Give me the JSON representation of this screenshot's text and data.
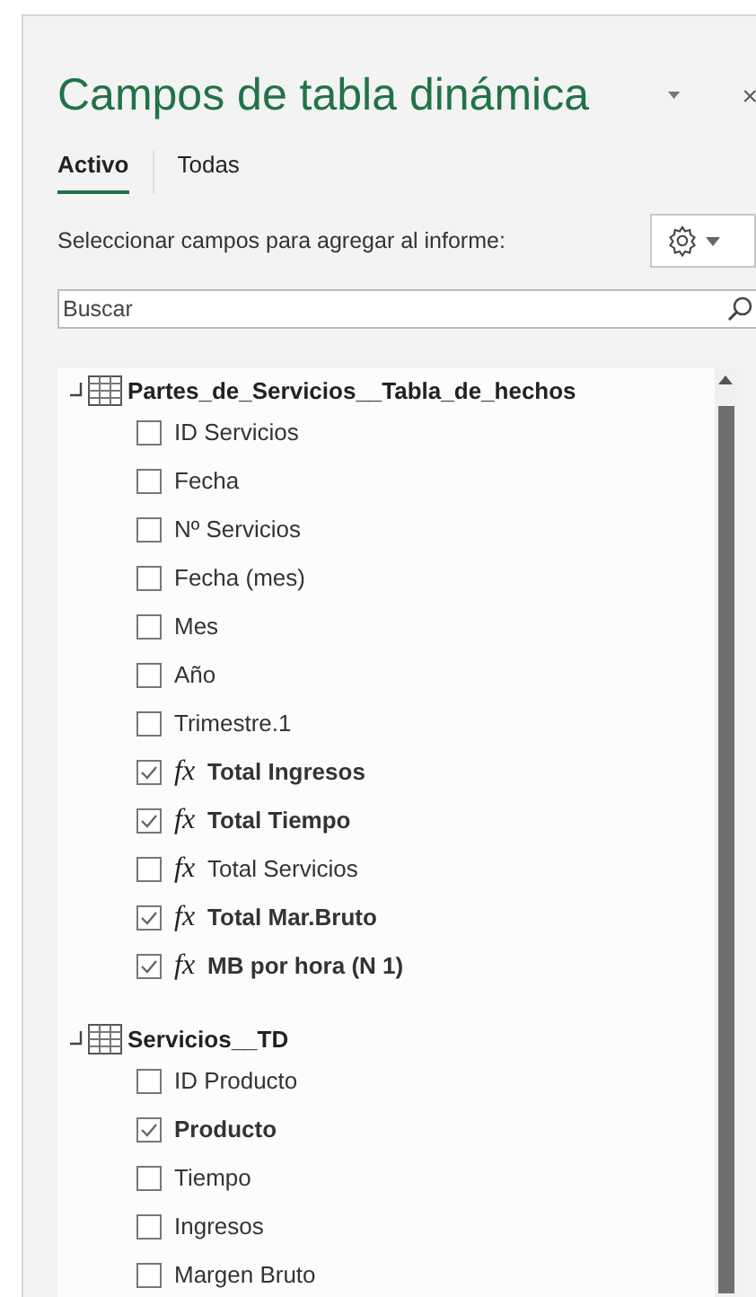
{
  "panel": {
    "title": "Campos de tabla dinámica"
  },
  "tabs": [
    {
      "label": "Activo",
      "selected": true
    },
    {
      "label": "Todas",
      "selected": false
    }
  ],
  "instruction": "Seleccionar campos para agregar al informe:",
  "search": {
    "placeholder": "Buscar"
  },
  "tables": [
    {
      "name": "Partes_de_Servicios__Tabla_de_hechos",
      "expanded": true,
      "fields": [
        {
          "label": "ID Servicios",
          "checked": false
        },
        {
          "label": "Fecha",
          "checked": false
        },
        {
          "label": "Nº Servicios",
          "checked": false
        },
        {
          "label": "Fecha (mes)",
          "checked": false
        },
        {
          "label": "Mes",
          "checked": false
        },
        {
          "label": "Año",
          "checked": false
        },
        {
          "label": "Trimestre.1",
          "checked": false
        },
        {
          "label": "Total Ingresos",
          "checked": true,
          "prefix": "fx"
        },
        {
          "label": "Total Tiempo",
          "checked": true,
          "prefix": "fx"
        },
        {
          "label": "Total Servicios",
          "checked": false,
          "prefix": "fx"
        },
        {
          "label": "Total Mar.Bruto",
          "checked": true,
          "prefix": "fx"
        },
        {
          "label": "MB por hora (N 1)",
          "checked": true,
          "prefix": "fx"
        }
      ]
    },
    {
      "name": "Servicios__TD",
      "expanded": true,
      "fields": [
        {
          "label": "ID Producto",
          "checked": false
        },
        {
          "label": "Producto",
          "checked": true
        },
        {
          "label": "Tiempo",
          "checked": false
        },
        {
          "label": "Ingresos",
          "checked": false
        },
        {
          "label": "Margen Bruto",
          "checked": false
        }
      ]
    }
  ]
}
